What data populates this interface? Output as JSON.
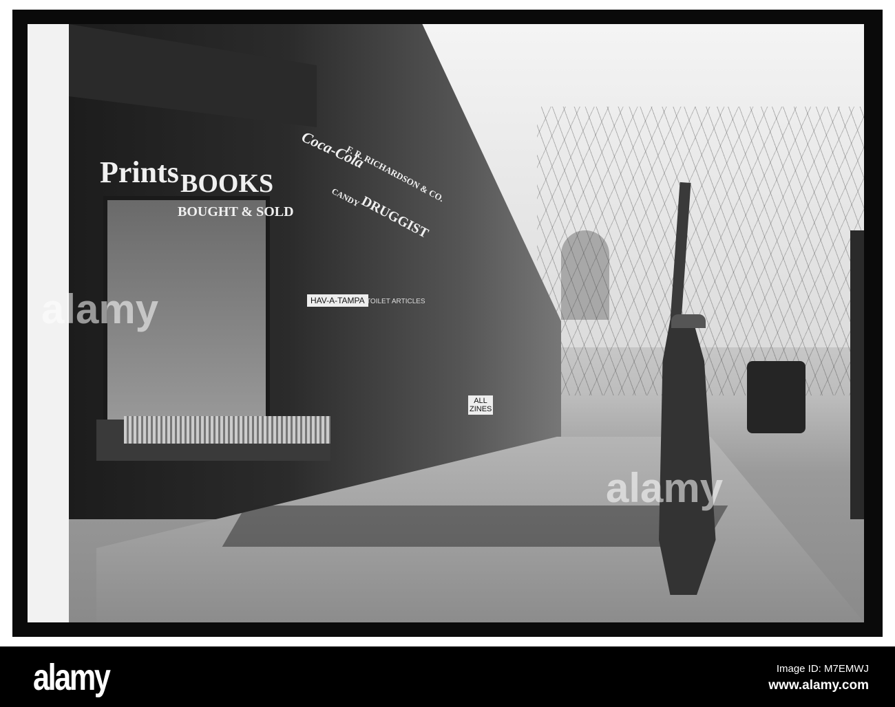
{
  "photo": {
    "signs": {
      "prints": "Prints",
      "books": "BOOKS",
      "bought_sold": "BOUGHT & SOLD",
      "coca_cola": "Coca-Cola",
      "richardson": "F. R. RICHARDSON & CO.",
      "candy": "CANDY",
      "druggist": "DRUGGIST",
      "hav_a_tampa": "HAV-A-TAMPA",
      "toilet_articles": "TOILET ARTICLES",
      "magazines": "ALL ZINES"
    },
    "watermark": "alamy"
  },
  "footer": {
    "logo": "alamy",
    "image_id": "Image ID: M7EMWJ",
    "url": "www.alamy.com"
  }
}
